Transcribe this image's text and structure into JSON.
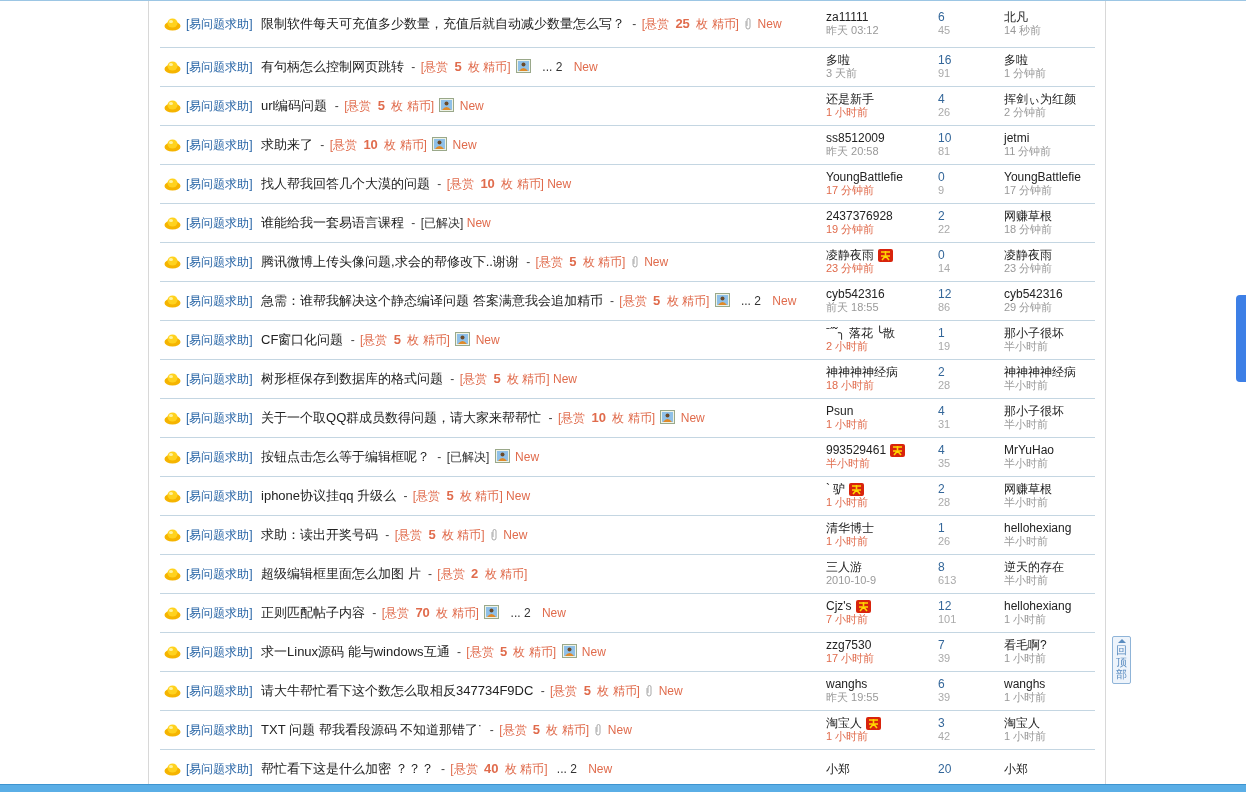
{
  "threads": [
    {
      "category": "[易问题求助]",
      "title": "限制软件每天可充值多少数量，充值后就自动减少数量怎么写？",
      "separator": "-",
      "reward": {
        "kind": "bounty",
        "text": "[悬赏 **25** 枚 精币]"
      },
      "attachment": {
        "kind": "clip"
      },
      "new": "New",
      "author": {
        "name": "za11111",
        "badge": false,
        "time": "昨天 03:12",
        "recent": false
      },
      "replies": "6",
      "views": "45",
      "last": {
        "name": "北凡",
        "time": "14 秒前"
      }
    },
    {
      "category": "[易问题求助]",
      "title": "有句柄怎么控制网页跳转",
      "separator": "-",
      "reward": {
        "kind": "bounty",
        "text": "[悬赏 **5** 枚 精币]"
      },
      "attachment": {
        "kind": "image"
      },
      "pages": "... 2",
      "new": "New",
      "author": {
        "name": "多啦",
        "badge": false,
        "time": "3 天前",
        "recent": false
      },
      "replies": "16",
      "views": "91",
      "last": {
        "name": "多啦",
        "time": "1 分钟前"
      }
    },
    {
      "category": "[易问题求助]",
      "title": "url编码问题",
      "separator": "-",
      "reward": {
        "kind": "bounty",
        "text": "[悬赏 **5** 枚 精币]"
      },
      "attachment": {
        "kind": "image"
      },
      "new": "New",
      "author": {
        "name": "还是新手",
        "badge": false,
        "time": "1 小时前",
        "recent": true
      },
      "replies": "4",
      "views": "26",
      "last": {
        "name": "挥剑ぃ为红颜",
        "time": "2 分钟前"
      }
    },
    {
      "category": "[易问题求助]",
      "title": "求助来了",
      "separator": "-",
      "reward": {
        "kind": "bounty",
        "text": "[悬赏 **10** 枚 精币]"
      },
      "attachment": {
        "kind": "image"
      },
      "new": "New",
      "author": {
        "name": "ss8512009",
        "badge": false,
        "time": "昨天 20:58",
        "recent": false
      },
      "replies": "10",
      "views": "81",
      "last": {
        "name": "jetmi",
        "time": "11 分钟前"
      }
    },
    {
      "category": "[易问题求助]",
      "title": "找人帮我回答几个大漠的问题",
      "separator": "-",
      "reward": {
        "kind": "bounty",
        "text": "[悬赏 **10** 枚 精币]"
      },
      "new": "New",
      "author": {
        "name": "YoungBattlefie",
        "badge": false,
        "time": "17 分钟前",
        "recent": true
      },
      "replies": "0",
      "views": "9",
      "last": {
        "name": "YoungBattlefie",
        "time": "17 分钟前"
      }
    },
    {
      "category": "[易问题求助]",
      "title": "谁能给我一套易语言课程",
      "separator": "-",
      "reward": {
        "kind": "solved",
        "text": "[已解决]"
      },
      "new": "New",
      "author": {
        "name": "2437376928",
        "badge": false,
        "time": "19 分钟前",
        "recent": true
      },
      "replies": "2",
      "views": "22",
      "last": {
        "name": "网赚草根",
        "time": "18 分钟前"
      }
    },
    {
      "category": "[易问题求助]",
      "title": "腾讯微博上传头像问题,求会的帮修改下..谢谢",
      "separator": "-",
      "reward": {
        "kind": "bounty",
        "text": "[悬赏 **5** 枚 精币]"
      },
      "attachment": {
        "kind": "clip"
      },
      "new": "New",
      "author": {
        "name": "凌静夜雨",
        "badge": true,
        "time": "23 分钟前",
        "recent": true
      },
      "replies": "0",
      "views": "14",
      "last": {
        "name": "凌静夜雨",
        "time": "23 分钟前"
      }
    },
    {
      "category": "[易问题求助]",
      "title": "急需：谁帮我解决这个静态编译问题 答案满意我会追加精币",
      "separator": "-",
      "reward": {
        "kind": "bounty",
        "text": "[悬赏 **5** 枚 精币]"
      },
      "attachment": {
        "kind": "image"
      },
      "pages": "... 2",
      "new": "New",
      "author": {
        "name": "cyb542316",
        "badge": false,
        "time": "前天 18:55",
        "recent": false
      },
      "replies": "12",
      "views": "86",
      "last": {
        "name": "cyb542316",
        "time": "29 分钟前"
      }
    },
    {
      "category": "[易问题求助]",
      "title": "CF窗口化问题",
      "separator": "-",
      "reward": {
        "kind": "bounty",
        "text": "[悬赏 **5** 枚 精币]"
      },
      "attachment": {
        "kind": "image"
      },
      "new": "New",
      "author": {
        "name": "ˉ˝ˇ╮ 落花 ╰散",
        "badge": false,
        "time": "2 小时前",
        "recent": true
      },
      "replies": "1",
      "views": "19",
      "last": {
        "name": "那小子很坏",
        "time": "半小时前"
      }
    },
    {
      "category": "[易问题求助]",
      "title": "树形框保存到数据库的格式问题",
      "separator": "-",
      "reward": {
        "kind": "bounty",
        "text": "[悬赏 **5** 枚 精币]"
      },
      "new": "New",
      "author": {
        "name": "神神神神经病",
        "badge": false,
        "time": "18 小时前",
        "recent": true
      },
      "replies": "2",
      "views": "28",
      "last": {
        "name": "神神神神经病",
        "time": "半小时前"
      }
    },
    {
      "category": "[易问题求助]",
      "title": "关于一个取QQ群成员数得问题，请大家来帮帮忙",
      "separator": "-",
      "reward": {
        "kind": "bounty",
        "text": "[悬赏 **10** 枚 精币]"
      },
      "attachment": {
        "kind": "image"
      },
      "new": "New",
      "author": {
        "name": "Psun",
        "badge": false,
        "time": "1 小时前",
        "recent": true
      },
      "replies": "4",
      "views": "31",
      "last": {
        "name": "那小子很坏",
        "time": "半小时前"
      }
    },
    {
      "category": "[易问题求助]",
      "title": "按钮点击怎么等于编辑框呢？",
      "separator": "-",
      "reward": {
        "kind": "solved",
        "text": "[已解决]"
      },
      "attachment": {
        "kind": "image"
      },
      "new": "New",
      "author": {
        "name": "993529461",
        "badge": true,
        "time": "半小时前",
        "recent": true
      },
      "replies": "4",
      "views": "35",
      "last": {
        "name": "MrYuHao",
        "time": "半小时前"
      }
    },
    {
      "category": "[易问题求助]",
      "title": "iphone协议挂qq 升级么",
      "separator": "-",
      "reward": {
        "kind": "bounty",
        "text": "[悬赏 **5** 枚 精币]"
      },
      "new": "New",
      "author": {
        "name": "` 驴",
        "badge": true,
        "time": "1 小时前",
        "recent": true
      },
      "replies": "2",
      "views": "28",
      "last": {
        "name": "网赚草根",
        "time": "半小时前"
      }
    },
    {
      "category": "[易问题求助]",
      "title": "求助：读出开奖号码",
      "separator": "-",
      "reward": {
        "kind": "bounty",
        "text": "[悬赏 **5** 枚 精币]"
      },
      "attachment": {
        "kind": "clip"
      },
      "new": "New",
      "author": {
        "name": "清华博士",
        "badge": false,
        "time": "1 小时前",
        "recent": true
      },
      "replies": "1",
      "views": "26",
      "last": {
        "name": "hellohexiang",
        "time": "半小时前"
      }
    },
    {
      "category": "[易问题求助]",
      "title": "超级编辑框里面怎么加图 片",
      "separator": "-",
      "reward": {
        "kind": "bounty",
        "text": "[悬赏 **2** 枚 精币]"
      },
      "author": {
        "name": "三人游",
        "badge": false,
        "time": "2010-10-9",
        "recent": false
      },
      "replies": "8",
      "views": "613",
      "last": {
        "name": "逆天的存在",
        "time": "半小时前"
      }
    },
    {
      "category": "[易问题求助]",
      "title": "正则匹配帖子内容",
      "separator": "-",
      "reward": {
        "kind": "bounty",
        "text": "[悬赏 **70** 枚 精币]"
      },
      "attachment": {
        "kind": "image"
      },
      "pages": "... 2",
      "new": "New",
      "author": {
        "name": "Cjz's",
        "badge": true,
        "time": "7 小时前",
        "recent": true
      },
      "replies": "12",
      "views": "101",
      "last": {
        "name": "hellohexiang",
        "time": "1 小时前"
      }
    },
    {
      "category": "[易问题求助]",
      "title": "求一Linux源码 能与windows互通",
      "separator": "-",
      "reward": {
        "kind": "bounty",
        "text": "[悬赏 **5** 枚 精币]"
      },
      "attachment": {
        "kind": "image"
      },
      "new": "New",
      "author": {
        "name": "zzg7530",
        "badge": false,
        "time": "17 小时前",
        "recent": true
      },
      "replies": "7",
      "views": "39",
      "last": {
        "name": "看毛啊?",
        "time": "1 小时前"
      }
    },
    {
      "category": "[易问题求助]",
      "title": "请大牛帮忙看下这个数怎么取相反347734F9DC",
      "separator": "-",
      "reward": {
        "kind": "bounty",
        "text": "[悬赏 **5** 枚 精币]"
      },
      "attachment": {
        "kind": "clip"
      },
      "new": "New",
      "author": {
        "name": "wanghs",
        "badge": false,
        "time": "昨天 19:55",
        "recent": false
      },
      "replies": "6",
      "views": "39",
      "last": {
        "name": "wanghs",
        "time": "1 小时前"
      }
    },
    {
      "category": "[易问题求助]",
      "title": "TXT 问题 帮我看段源码 不知道那错了˙",
      "separator": "-",
      "reward": {
        "kind": "bounty",
        "text": "[悬赏 **5** 枚 精币]"
      },
      "attachment": {
        "kind": "clip"
      },
      "new": "New",
      "author": {
        "name": "淘宝人",
        "badge": true,
        "time": "1 小时前",
        "recent": true
      },
      "replies": "3",
      "views": "42",
      "last": {
        "name": "淘宝人",
        "time": "1 小时前"
      }
    },
    {
      "category": "[易问题求助]",
      "title": "帮忙看下这是什么加密 ？？？",
      "separator": "-",
      "reward": {
        "kind": "bounty",
        "text": "[悬赏 **40** 枚 精币]"
      },
      "pages": "... 2",
      "new": "New",
      "author": {
        "name": "小郑",
        "badge": false
      },
      "replies": "20",
      "last": {
        "name": "小郑"
      }
    }
  ],
  "back_to_top": "回顶部"
}
